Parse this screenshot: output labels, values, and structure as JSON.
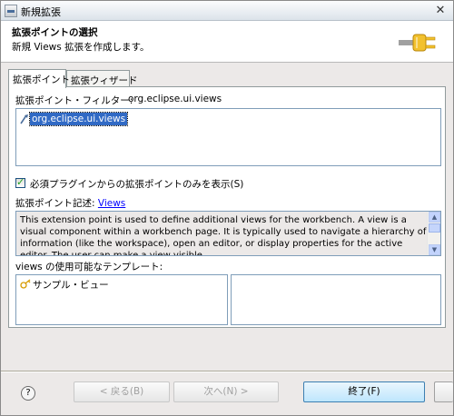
{
  "window": {
    "title": "新規拡張",
    "close_glyph": "✕"
  },
  "banner": {
    "title": "拡張ポイントの選択",
    "message": "新規 Views 拡張を作成します。",
    "icon": "plug-icon"
  },
  "tabs": [
    {
      "label": "拡張ポイント",
      "active": true
    },
    {
      "label": "拡張ウィザード",
      "active": false
    }
  ],
  "filter": {
    "label": "拡張ポイント・フィルター:",
    "value": "org.eclipse.ui.views"
  },
  "extension_points": [
    {
      "label": "org.eclipse.ui.views",
      "icon": "extension-point-icon",
      "selected": true
    }
  ],
  "only_required_checkbox": {
    "label": "必須プラグインからの拡張ポイントのみを表示(S)",
    "checked": true
  },
  "description": {
    "label": "拡張ポイント記述:",
    "link": "Views",
    "text": "This extension point is used to define additional views for the workbench. A view is a visual component within a workbench page. It is typically used to navigate a hierarchy of information (like the workspace), open an editor, or display properties for the active editor. The user can make a view visible"
  },
  "templates": {
    "label": "views の使用可能なテンプレート:",
    "items": [
      {
        "label": "サンプル・ビュー",
        "icon": "template-icon"
      }
    ]
  },
  "footer": {
    "help_glyph": "?",
    "back": "< 戻る(B)",
    "next": "次へ(N) >",
    "finish": "終了(F)"
  },
  "colors": {
    "selection": "#316ac5",
    "link": "#0000ff"
  }
}
